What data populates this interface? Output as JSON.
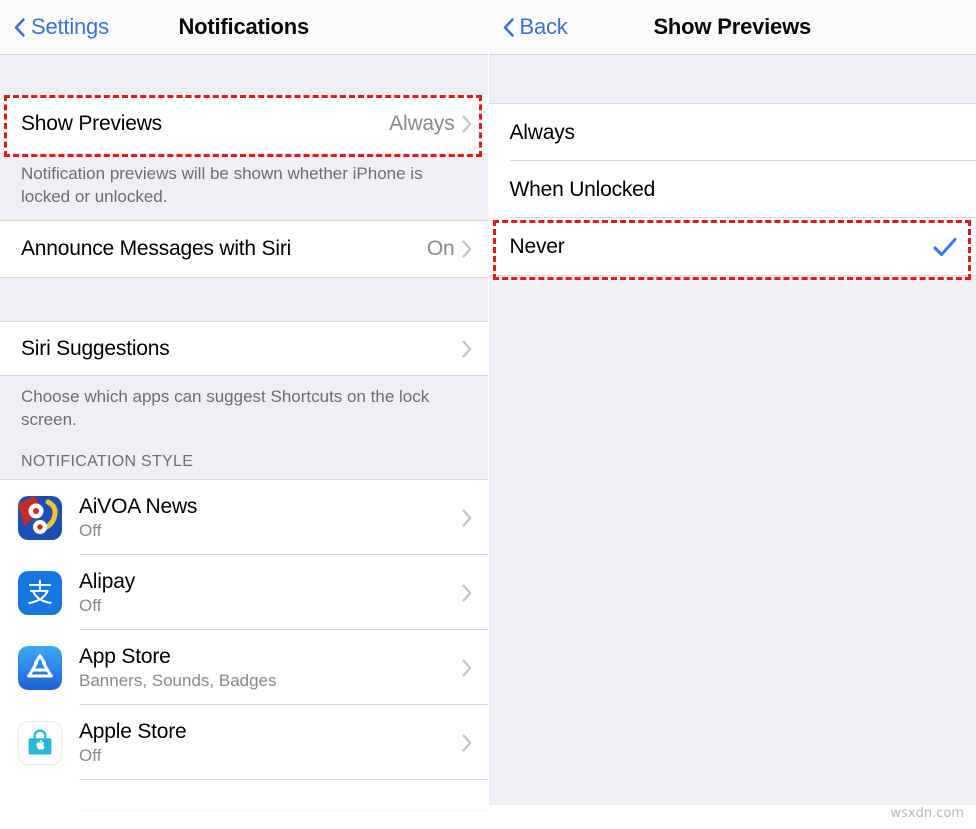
{
  "left": {
    "nav": {
      "back_label": "Settings",
      "back_icon": "chevron-left-icon",
      "title": "Notifications"
    },
    "show_previews_row": {
      "title": "Show Previews",
      "value": "Always",
      "disclosure_icon": "chevron-right-icon"
    },
    "show_previews_footer": "Notification previews will be shown whether iPhone is locked or unlocked.",
    "announce_row": {
      "title": "Announce Messages with Siri",
      "value": "On",
      "disclosure_icon": "chevron-right-icon"
    },
    "siri_suggestions_row": {
      "title": "Siri Suggestions",
      "value": "",
      "disclosure_icon": "chevron-right-icon"
    },
    "siri_suggestions_footer": "Choose which apps can suggest Shortcuts on the lock screen.",
    "notification_style_header": "NOTIFICATION STYLE",
    "apps": [
      {
        "name": "AiVOA News",
        "status": "Off",
        "icon": "aivoa-news-app-icon"
      },
      {
        "name": "Alipay",
        "status": "Off",
        "icon": "alipay-app-icon"
      },
      {
        "name": "App Store",
        "status": "Banners, Sounds, Badges",
        "icon": "app-store-app-icon"
      },
      {
        "name": "Apple Store",
        "status": "Off",
        "icon": "apple-store-app-icon"
      }
    ]
  },
  "right": {
    "nav": {
      "back_label": "Back",
      "back_icon": "chevron-left-icon",
      "title": "Show Previews"
    },
    "options": [
      {
        "label": "Always",
        "selected": false
      },
      {
        "label": "When Unlocked",
        "selected": false
      },
      {
        "label": "Never",
        "selected": true
      }
    ],
    "check_icon": "checkmark-icon"
  },
  "annotations": {
    "highlight_color": "#e01b1b",
    "highlight_left_target": "Show Previews",
    "highlight_right_target": "Never"
  },
  "watermark": "wsxdn.com",
  "colors": {
    "accent_blue": "#3c72d8",
    "check_blue": "#3478f6",
    "group_bg": "#efeff4",
    "separator": "#d9d9dd",
    "secondary_text": "#8a8a8e"
  }
}
